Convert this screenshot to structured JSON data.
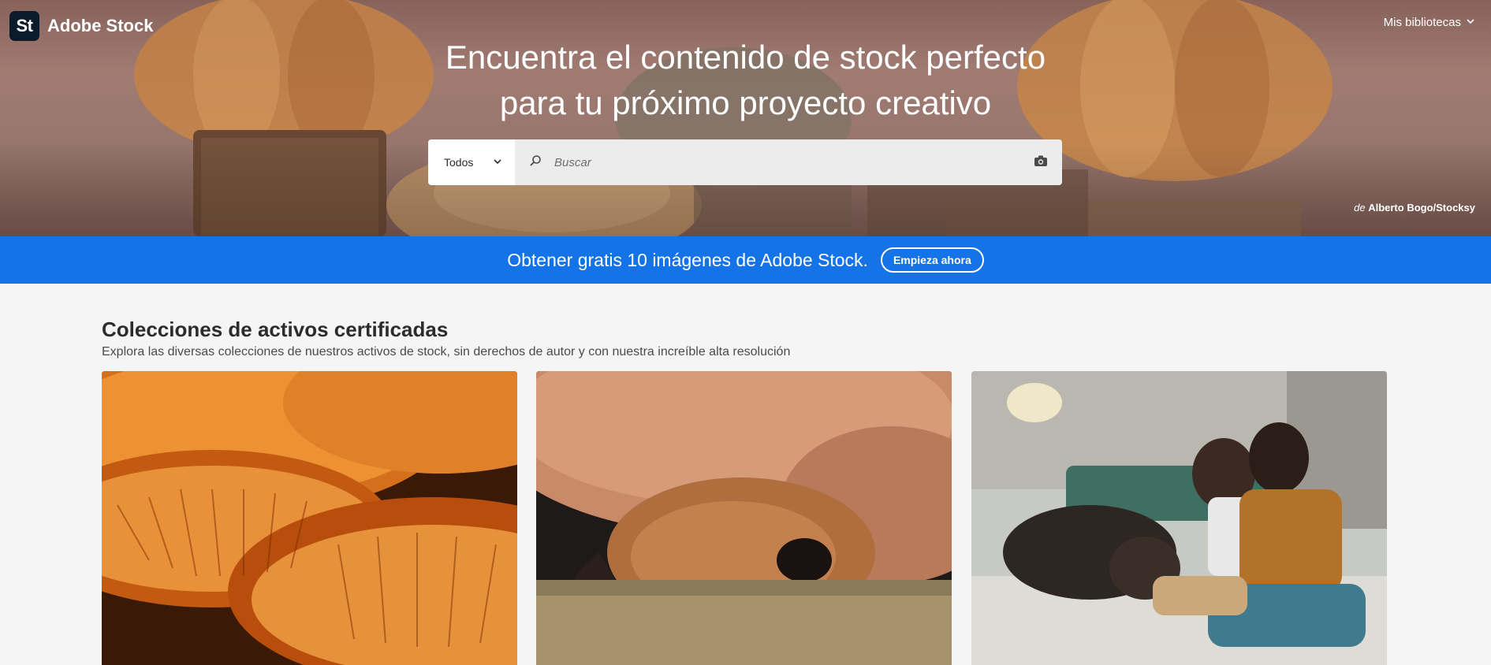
{
  "brand": {
    "logo_text": "St",
    "name": "Adobe Stock"
  },
  "header": {
    "libraries_label": "Mis bibliotecas"
  },
  "hero": {
    "title_line1": "Encuentra el contenido de stock perfecto",
    "title_line2": "para tu próximo proyecto creativo",
    "credit_prefix": "de",
    "credit_author": "Alberto Bogo/Stocksy"
  },
  "search": {
    "type_label": "Todos",
    "placeholder": "Buscar",
    "value": ""
  },
  "promo": {
    "text": "Obtener gratis 10 imágenes de Adobe Stock.",
    "button_label": "Empieza ahora"
  },
  "collections": {
    "title": "Colecciones de activos certificadas",
    "subtitle": "Explora las diversas colecciones de nuestros activos de stock, sin derechos de autor y con nuestra increíble alta resolución",
    "cards": [
      {
        "subject": "mushroom-gills-image"
      },
      {
        "subject": "sleeping-dog-image"
      },
      {
        "subject": "men-with-dog-image"
      }
    ]
  },
  "colors": {
    "promo_blue": "#1473e6",
    "brand_dark": "#0b1b2b",
    "page_bg": "#f5f5f5"
  }
}
